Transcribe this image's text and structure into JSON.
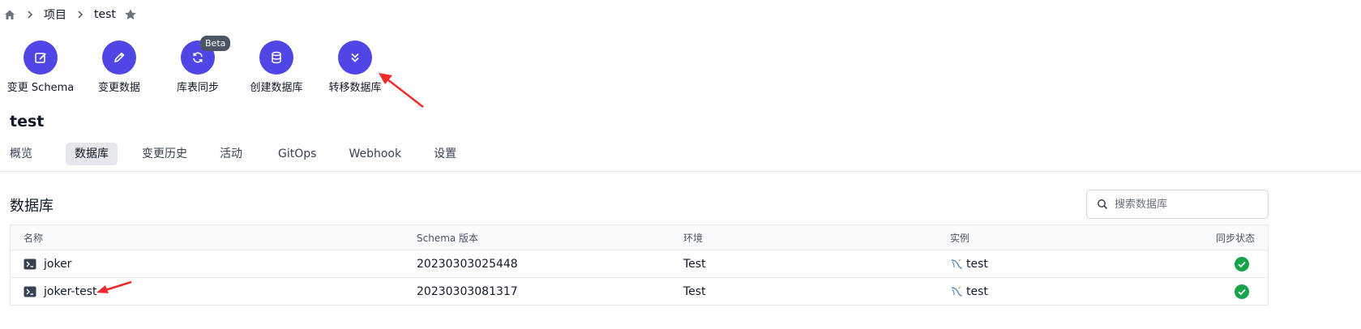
{
  "breadcrumb": {
    "items": [
      "项目",
      "test"
    ]
  },
  "quick_actions": [
    {
      "label": "变更 Schema",
      "icon": "edit-square-icon"
    },
    {
      "label": "变更数据",
      "icon": "pencil-icon"
    },
    {
      "label": "库表同步",
      "icon": "refresh-icon",
      "badge": "Beta"
    },
    {
      "label": "创建数据库",
      "icon": "database-icon"
    },
    {
      "label": "转移数据库",
      "icon": "double-chevron-down-icon"
    }
  ],
  "project": {
    "title": "test"
  },
  "tabs": [
    {
      "label": "概览"
    },
    {
      "label": "数据库",
      "active": true
    },
    {
      "label": "变更历史"
    },
    {
      "label": "活动"
    },
    {
      "label": "GitOps"
    },
    {
      "label": "Webhook"
    },
    {
      "label": "设置"
    }
  ],
  "section": {
    "title": "数据库"
  },
  "search": {
    "placeholder": "搜索数据库"
  },
  "table": {
    "headers": [
      "名称",
      "Schema 版本",
      "环境",
      "实例",
      "同步状态"
    ],
    "rows": [
      {
        "name": "joker",
        "version": "20230303025448",
        "env": "Test",
        "instance": "test",
        "sync": "ok"
      },
      {
        "name": "joker-test",
        "version": "20230303081317",
        "env": "Test",
        "instance": "test",
        "sync": "ok"
      }
    ]
  },
  "colors": {
    "accent": "#4f46e5",
    "success": "#16a34a",
    "annotation": "#ef2b2b"
  }
}
